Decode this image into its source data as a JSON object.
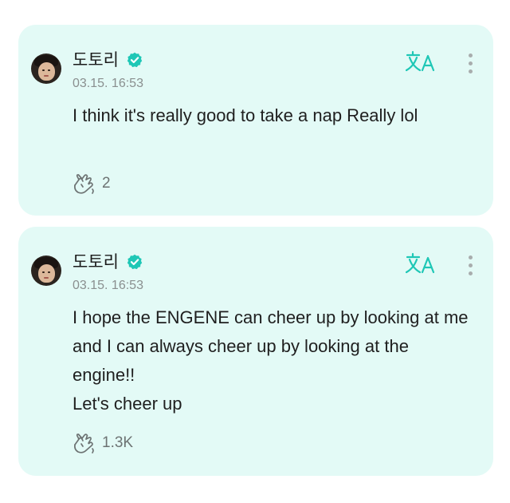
{
  "posts": [
    {
      "author": "도토리",
      "timestamp": "03.15. 16:53",
      "lines": [
        "I think it's really good to take a nap Really lol"
      ],
      "reactions": "2",
      "icons": {
        "verified": "verified-badge-icon",
        "translate": "translate-icon",
        "more": "more-vertical-icon",
        "reaction": "reaction-hands-icon"
      }
    },
    {
      "author": "도토리",
      "timestamp": "03.15. 16:53",
      "lines": [
        "I hope the ENGENE can cheer up by looking at me and I can always cheer up by looking at the engine!!",
        "Let's cheer up"
      ],
      "reactions": "1.3K",
      "icons": {
        "verified": "verified-badge-icon",
        "translate": "translate-icon",
        "more": "more-vertical-icon",
        "reaction": "reaction-hands-icon"
      }
    }
  ],
  "colors": {
    "card_background": "#e3faf6",
    "accent": "#1fc7b6",
    "timestamp": "#8a8f8f",
    "text": "#1f1f1f"
  }
}
